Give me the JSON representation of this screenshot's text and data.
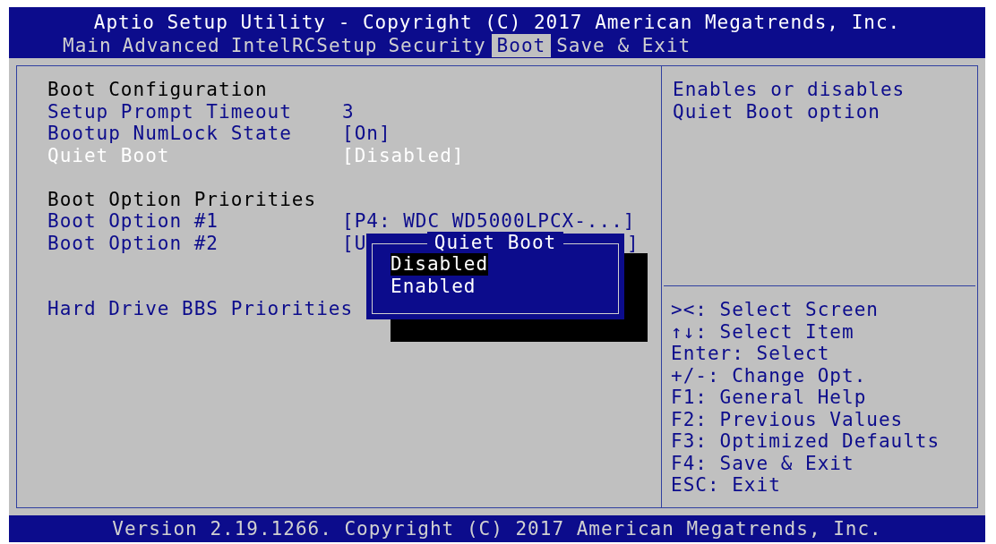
{
  "header": {
    "title": "Aptio Setup Utility - Copyright (C) 2017 American Megatrends, Inc."
  },
  "tabs": [
    {
      "label": "Main",
      "selected": false
    },
    {
      "label": "Advanced",
      "selected": false
    },
    {
      "label": "IntelRCSetup",
      "selected": false
    },
    {
      "label": "Security",
      "selected": false
    },
    {
      "label": "Boot",
      "selected": true
    },
    {
      "label": "Save & Exit",
      "selected": false
    }
  ],
  "settings": [
    {
      "kind": "heading",
      "label": "Boot Configuration"
    },
    {
      "kind": "option",
      "label": "Setup Prompt Timeout",
      "value": "3",
      "selected": false
    },
    {
      "kind": "option",
      "label": "Bootup NumLock State",
      "value": "[On]",
      "selected": false
    },
    {
      "kind": "option",
      "label": "Quiet Boot",
      "value": "[Disabled]",
      "selected": true
    },
    {
      "kind": "blank"
    },
    {
      "kind": "heading",
      "label": "Boot Option Priorities"
    },
    {
      "kind": "option",
      "label": "Boot Option #1",
      "value": "[P4: WDC WD5000LPCX-...]",
      "selected": false
    },
    {
      "kind": "option",
      "label": "Boot Option #2",
      "value": "[U",
      "value_end": "]",
      "selected": false
    },
    {
      "kind": "blank"
    },
    {
      "kind": "blank"
    },
    {
      "kind": "option",
      "label": "Hard Drive BBS Priorities",
      "selected": false
    }
  ],
  "popup": {
    "title": "Quiet Boot",
    "options": [
      {
        "label": "Disabled",
        "selected": true
      },
      {
        "label": "Enabled",
        "selected": false
      }
    ]
  },
  "help_text": [
    "Enables or disables",
    "Quiet Boot option"
  ],
  "key_hints": [
    "><: Select Screen",
    "↑↓: Select Item",
    "Enter: Select",
    "+/-: Change Opt.",
    "F1: General Help",
    "F2: Previous Values",
    "F3: Optimized Defaults",
    "F4: Save & Exit",
    "ESC: Exit"
  ],
  "footer": {
    "text": "Version 2.19.1266. Copyright (C) 2017 American Megatrends, Inc."
  }
}
